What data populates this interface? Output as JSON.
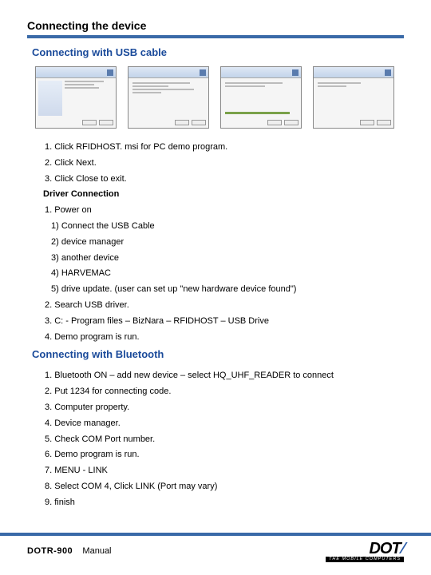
{
  "title": "Connecting the device",
  "section1": {
    "heading": "Connecting with USB cable",
    "steps_a": [
      "1. Click RFIDHOST. msi for PC demo program.",
      "2. Click Next.",
      "3. Click Close to exit."
    ],
    "sub_heading": "Driver  Connection",
    "sub_a": [
      "1. Power on",
      "1) Connect the USB Cable",
      "2) device manager",
      "3) another device",
      "4) HARVEMAC",
      "5) drive update. (user can set up \"new hardware device found\")"
    ],
    "steps_b": [
      "2. Search USB driver.",
      "3. C: - Program files – BizNara – RFIDHOST – USB Drive",
      "4. Demo program is run."
    ]
  },
  "section2": {
    "heading": "Connecting with Bluetooth",
    "steps": [
      "1. Bluetooth ON – add new device – select HQ_UHF_READER to connect",
      "2. Put 1234 for connecting code.",
      "3. Computer property.",
      "4. Device manager.",
      "5. Check COM Port number.",
      "6. Demo program is run.",
      "7. MENU - LINK",
      "8. Select COM 4, Click LINK (Port may vary)",
      "9. finish"
    ]
  },
  "footer": {
    "model": "DOTR-900",
    "label": "Manual",
    "brand": "DOT",
    "tagline": "THE MOBILE COMPUTERS"
  }
}
